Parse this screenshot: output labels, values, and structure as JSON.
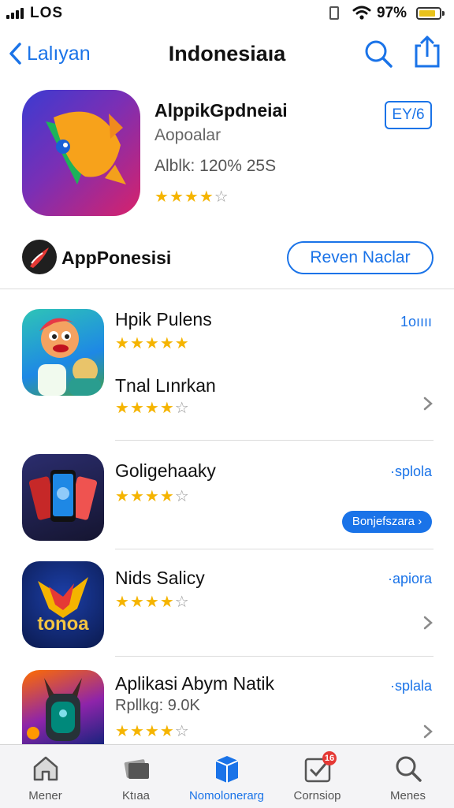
{
  "status": {
    "carrier": "LOS",
    "battery_pct": "97%"
  },
  "nav": {
    "back_label": "Lalıyan",
    "title": "Indonesiaıa"
  },
  "hero": {
    "name": "AlppikGpdneiai",
    "subtitle": "Aopoalar",
    "meta": "Alblk: 120% 25S",
    "button_label": "EY/6",
    "rating": 4
  },
  "developer": {
    "name": "AppPonesisi",
    "review_button": "Reven Naclar"
  },
  "list": [
    {
      "titles": [
        "Hpik Pulens",
        "Tnal Lınrkan"
      ],
      "rating": [
        4.5,
        4
      ],
      "right_text": "1oıııı"
    },
    {
      "titles": [
        "Goligehaaky"
      ],
      "rating": [
        4
      ],
      "right_text": "·splola",
      "pill": "Bonjefszara ›"
    },
    {
      "titles": [
        "Nids Salicy"
      ],
      "rating": [
        4
      ],
      "right_text": "·apiora",
      "icon_text": "tonoa"
    },
    {
      "titles": [
        "Aplikasi Abym Natik"
      ],
      "subtitle": "Rpllkg: 9.0K",
      "rating": [
        4
      ],
      "right_text": "·splala"
    }
  ],
  "tabs": [
    {
      "label": "Mener",
      "icon": "home-icon"
    },
    {
      "label": "Ktıaa",
      "icon": "cards-icon"
    },
    {
      "label": "Nomolonerarg",
      "icon": "apps-icon",
      "active": true
    },
    {
      "label": "Cornsiop",
      "icon": "calendar-check-icon",
      "badge": "16"
    },
    {
      "label": "Menes",
      "icon": "search-icon"
    }
  ],
  "colors": {
    "accent": "#1a73e8",
    "star": "#f5b400"
  }
}
